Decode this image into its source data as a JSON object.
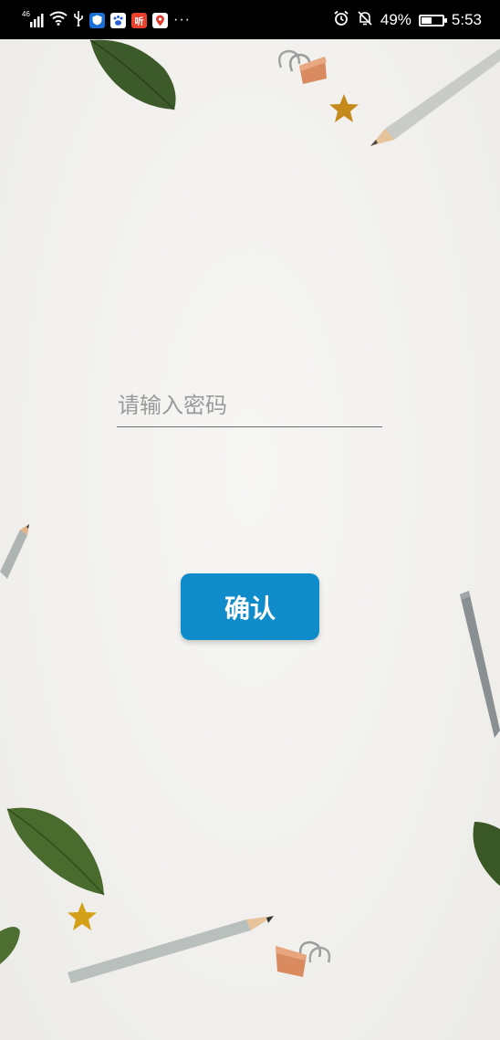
{
  "status_bar": {
    "network": "46",
    "battery_percent": "49%",
    "battery_level": 0.49,
    "time": "5:53",
    "more_notifications": "···",
    "app_icons": [
      "shield-app-icon",
      "paw-app-icon",
      "listen-app-icon",
      "map-pin-app-icon"
    ],
    "listen_label": "听"
  },
  "login": {
    "password_placeholder": "请输入密码",
    "confirm_label": "确认"
  },
  "colors": {
    "accent": "#118ccb",
    "status_bar_bg": "#000000",
    "background": "#f1f0ed"
  }
}
